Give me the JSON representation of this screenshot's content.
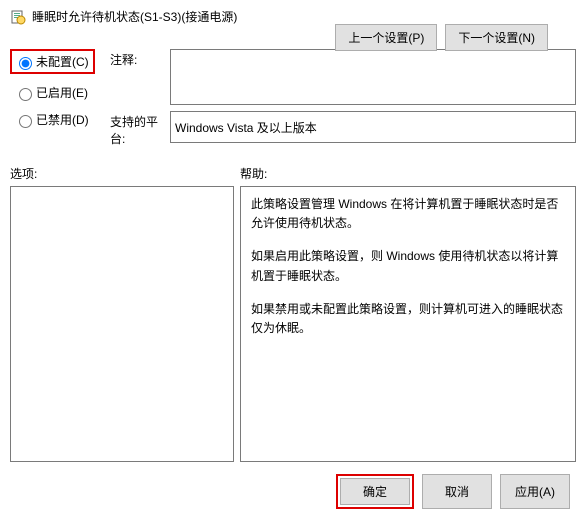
{
  "title": "睡眠时允许待机状态(S1-S3)(接通电源)",
  "nav": {
    "prev": "上一个设置(P)",
    "next": "下一个设置(N)"
  },
  "radios": {
    "not_configured": "未配置(C)",
    "enabled": "已启用(E)",
    "disabled": "已禁用(D)"
  },
  "labels": {
    "comment": "注释:",
    "supported": "支持的平台:",
    "options": "选项:",
    "help": "帮助:"
  },
  "fields": {
    "comment_value": "",
    "supported_value": "Windows Vista 及以上版本"
  },
  "help": {
    "p1": "此策略设置管理 Windows 在将计算机置于睡眠状态时是否允许使用待机状态。",
    "p2": "如果启用此策略设置，则 Windows 使用待机状态以将计算机置于睡眠状态。",
    "p3": "如果禁用或未配置此策略设置，则计算机可进入的睡眠状态仅为休眠。"
  },
  "footer": {
    "ok": "确定",
    "cancel": "取消",
    "apply": "应用(A)"
  }
}
